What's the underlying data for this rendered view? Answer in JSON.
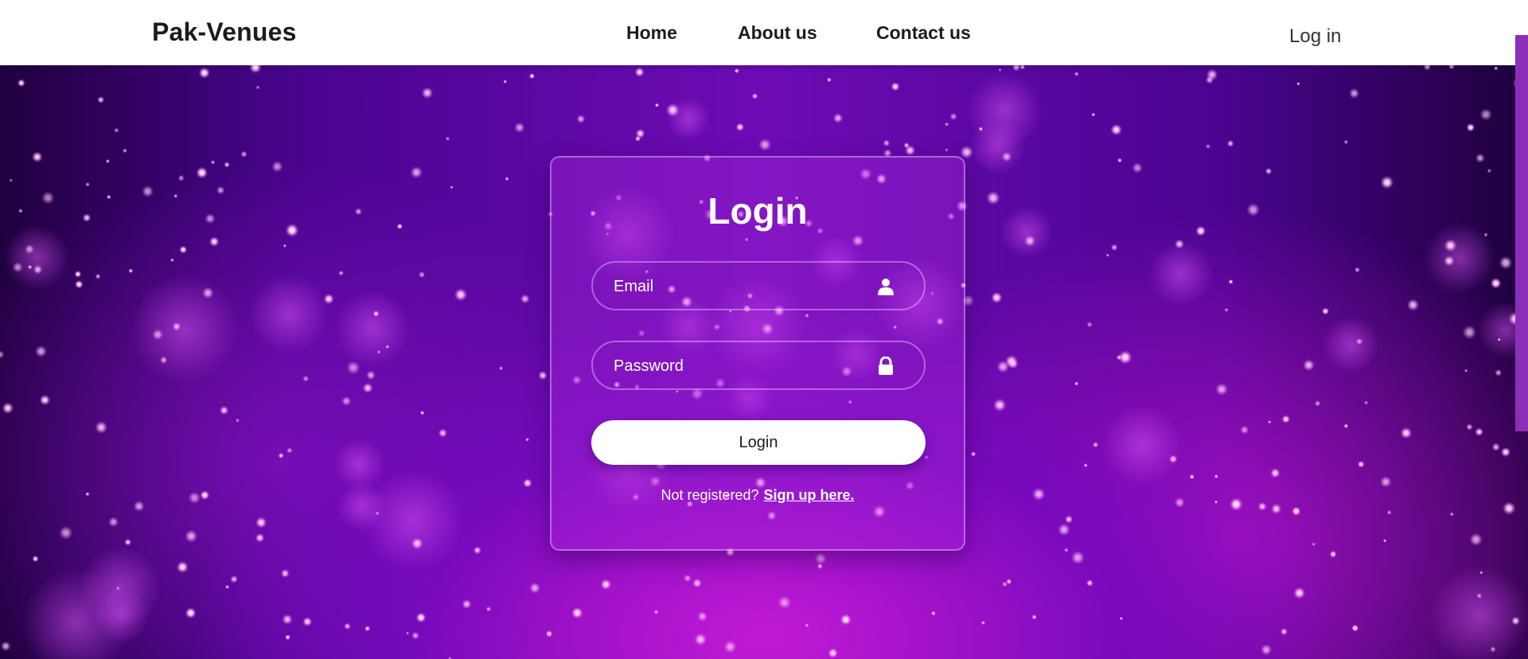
{
  "header": {
    "brand": "Pak-Venues",
    "nav": [
      {
        "label": "Home"
      },
      {
        "label": "About us"
      },
      {
        "label": "Contact us"
      }
    ],
    "login_link": "Log in"
  },
  "login_card": {
    "title": "Login",
    "email_placeholder": "Email",
    "email_icon": "user-icon",
    "password_placeholder": "Password",
    "password_icon": "lock-icon",
    "submit_label": "Login",
    "register_prompt": "Not registered?",
    "register_link": "Sign up here."
  },
  "colors": {
    "header_bg": "#ffffff",
    "background_accent": "#b010d0",
    "card_border": "#d9a6f0",
    "button_bg": "#ffffff"
  }
}
